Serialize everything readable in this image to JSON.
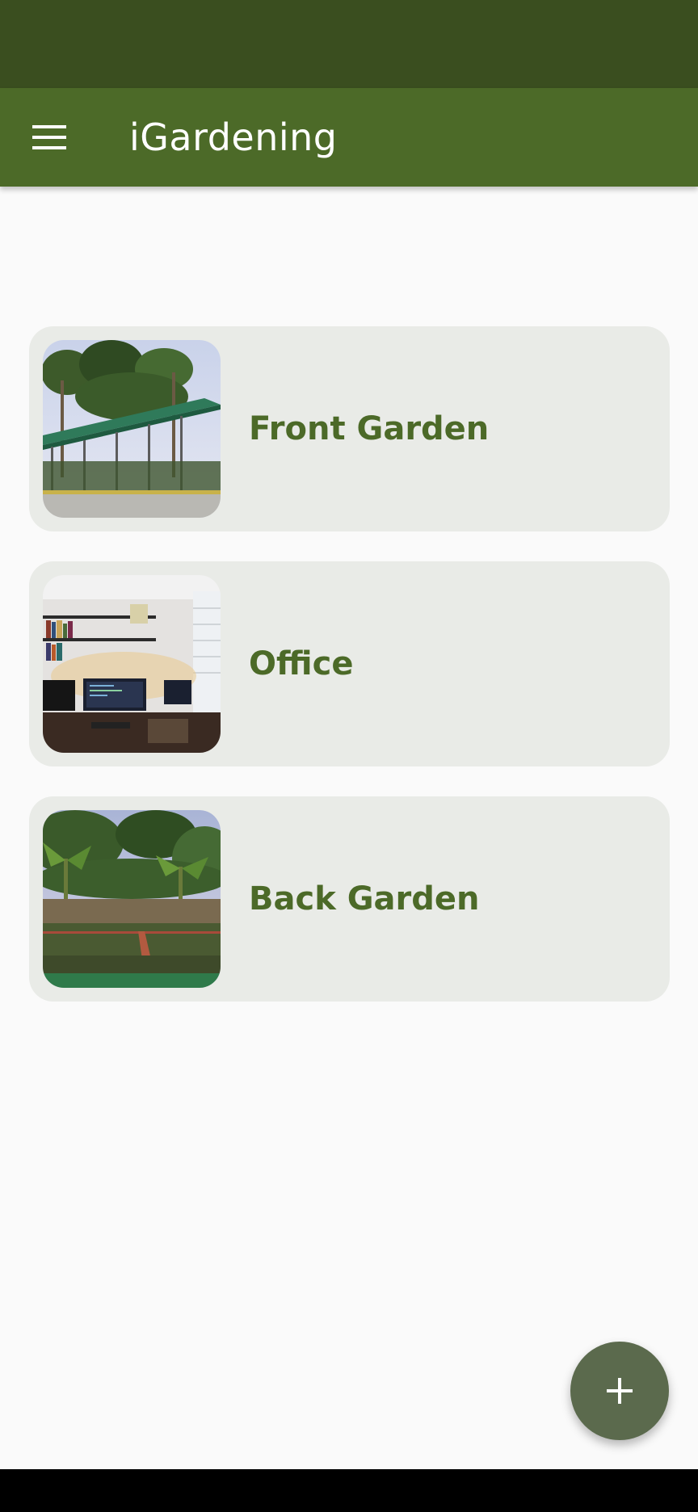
{
  "app_bar": {
    "title": "iGardening",
    "menu_icon": "menu-icon"
  },
  "locations": [
    {
      "label": "Front Garden",
      "image": "front-garden-photo"
    },
    {
      "label": "Office",
      "image": "office-photo"
    },
    {
      "label": "Back Garden",
      "image": "back-garden-photo"
    }
  ],
  "fab": {
    "icon": "plus-icon"
  },
  "colors": {
    "status_bar": "#3a4e1f",
    "app_bar": "#4c6a28",
    "card_background": "#e9ebe7",
    "card_text": "#4c6a28",
    "fab": "#5b6a4d",
    "background": "#fafafa"
  }
}
